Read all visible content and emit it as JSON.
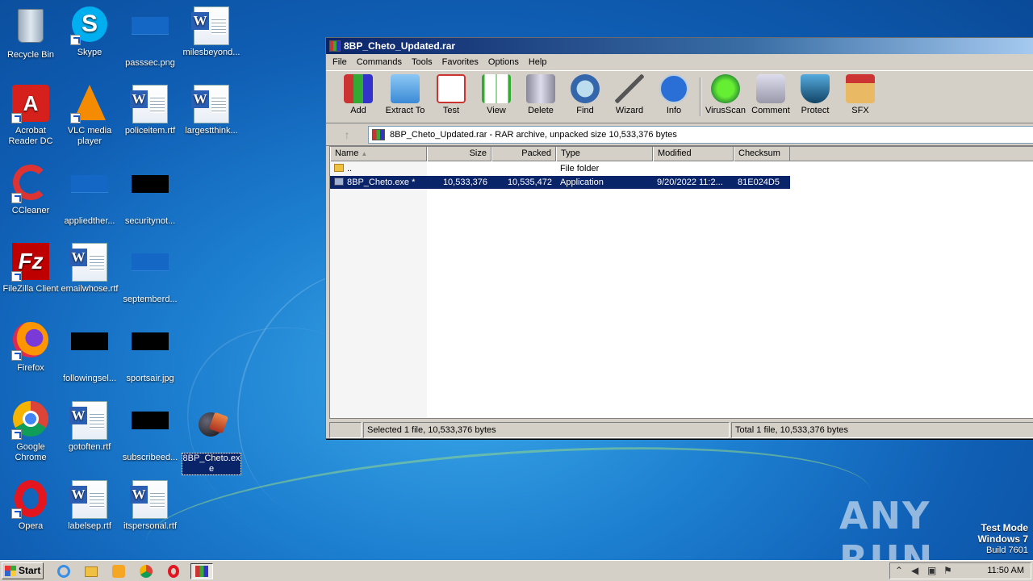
{
  "desktop": {
    "icons": [
      {
        "label": "Recycle Bin"
      },
      {
        "label": "Skype"
      },
      {
        "label": "passsec.png"
      },
      {
        "label": "milesbeyond..."
      },
      {
        "label": "Acrobat Reader DC"
      },
      {
        "label": "VLC media player"
      },
      {
        "label": "policeitem.rtf"
      },
      {
        "label": "largestthink..."
      },
      {
        "label": "CCleaner"
      },
      {
        "label": "appliedther..."
      },
      {
        "label": "securitynot..."
      },
      {
        "label": "FileZilla Client"
      },
      {
        "label": "emailwhose.rtf"
      },
      {
        "label": "septemberd..."
      },
      {
        "label": "Firefox"
      },
      {
        "label": "followingsel..."
      },
      {
        "label": "sportsair.jpg"
      },
      {
        "label": "Google Chrome"
      },
      {
        "label": "gotoften.rtf"
      },
      {
        "label": "subscribeed..."
      },
      {
        "label": "8BP_Cheto.exe"
      },
      {
        "label": "Opera"
      },
      {
        "label": "labelsep.rtf"
      },
      {
        "label": "itspersonal.rtf"
      }
    ]
  },
  "window": {
    "title": "8BP_Cheto_Updated.rar",
    "menu": [
      "File",
      "Commands",
      "Tools",
      "Favorites",
      "Options",
      "Help"
    ],
    "toolbar": [
      "Add",
      "Extract To",
      "Test",
      "View",
      "Delete",
      "Find",
      "Wizard",
      "Info",
      "VirusScan",
      "Comment",
      "Protect",
      "SFX"
    ],
    "address": "8BP_Cheto_Updated.rar - RAR archive, unpacked size 10,533,376 bytes",
    "columns": [
      "Name",
      "Size",
      "Packed",
      "Type",
      "Modified",
      "Checksum"
    ],
    "rows": [
      {
        "name": "..",
        "size": "",
        "packed": "",
        "type": "File folder",
        "modified": "",
        "checksum": ""
      },
      {
        "name": "8BP_Cheto.exe *",
        "size": "10,533,376",
        "packed": "10,535,472",
        "type": "Application",
        "modified": "9/20/2022 11:2...",
        "checksum": "81E024D5"
      }
    ],
    "status_left": "Selected 1 file, 10,533,376 bytes",
    "status_right": "Total 1 file, 10,533,376 bytes"
  },
  "taskbar": {
    "start_label": "Start",
    "clock": "11:50 AM"
  },
  "watermark": {
    "line1": "Test Mode",
    "line2": "Windows 7",
    "line3": "Build 7601",
    "brand": "ANY RUN"
  }
}
